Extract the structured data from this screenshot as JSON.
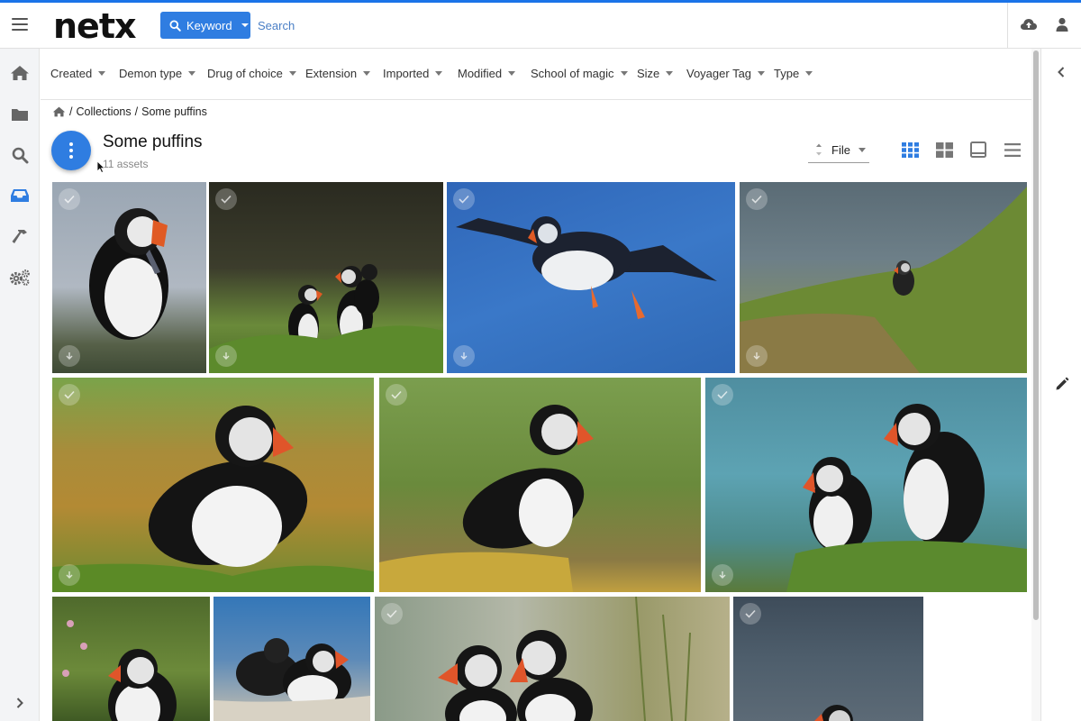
{
  "app": {
    "logo": "netx"
  },
  "header": {
    "search_mode_label": "Keyword",
    "search_placeholder": "Search"
  },
  "sidebar": {
    "items": [
      {
        "icon": "home-icon"
      },
      {
        "icon": "folder-icon"
      },
      {
        "icon": "search-icon"
      },
      {
        "icon": "inbox-icon",
        "active": true
      },
      {
        "icon": "hammer-icon"
      },
      {
        "icon": "gears-icon"
      }
    ]
  },
  "filters": [
    "Created",
    "Demon type",
    "Drug of choice",
    "Extension",
    "Imported",
    "Modified",
    "School of magic",
    "Size",
    "Voyager Tag",
    "Type"
  ],
  "breadcrumb": {
    "sep": "/",
    "items": [
      "Collections",
      "Some puffins"
    ]
  },
  "collection": {
    "title": "Some puffins",
    "count": "11 assets"
  },
  "sort": {
    "label": "File"
  },
  "colors": {
    "accent": "#2f7de1",
    "icon_grey": "#666666",
    "active_icon": "#2f7de1"
  },
  "assets": [
    {
      "name": "puffin-with-fish"
    },
    {
      "name": "three-puffins-grass"
    },
    {
      "name": "puffin-flying"
    },
    {
      "name": "puffin-cliff-sea"
    },
    {
      "name": "puffin-yellow-lichen"
    },
    {
      "name": "puffin-on-rock"
    },
    {
      "name": "two-puffins-teal"
    },
    {
      "name": "puffin-flowers"
    },
    {
      "name": "puffins-resting"
    },
    {
      "name": "two-puffins-closeup"
    },
    {
      "name": "puffin-grey-dusk"
    }
  ]
}
